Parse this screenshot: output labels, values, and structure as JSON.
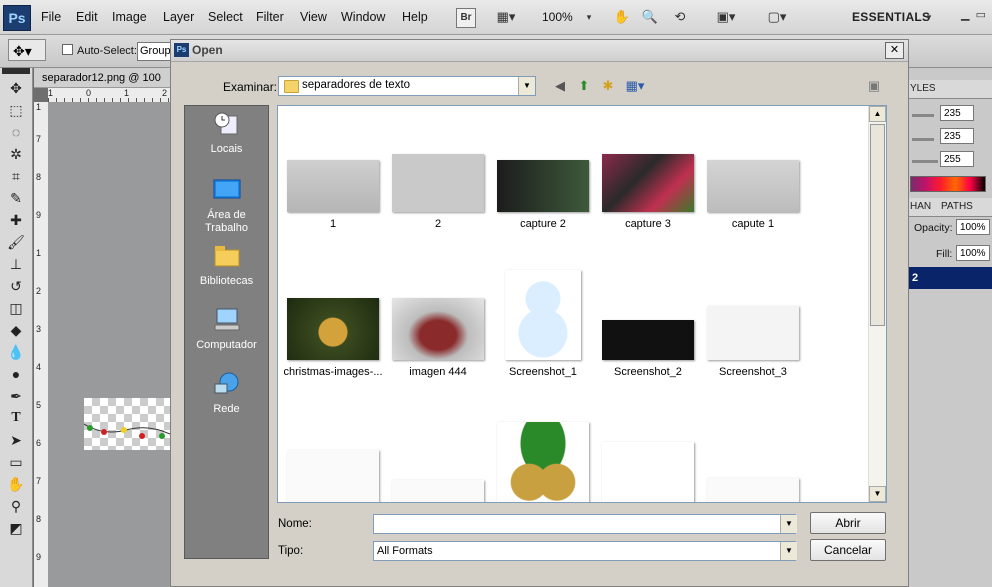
{
  "app": {
    "logo": "Ps"
  },
  "menu": [
    "File",
    "Edit",
    "Image",
    "Layer",
    "Select",
    "Filter",
    "View",
    "Window",
    "Help"
  ],
  "menubar": {
    "bridge": "Br",
    "zoom": "100%",
    "workspace": "ESSENTIALS"
  },
  "options": {
    "auto_select_label": "Auto-Select:",
    "auto_select_value": "Group"
  },
  "document": {
    "tab_title": "separador12.png @ 100",
    "ruler_h": [
      "1",
      "0",
      "1",
      "2"
    ],
    "ruler_v": [
      "1",
      "7",
      "8",
      "9",
      "1",
      "2",
      "3",
      "4",
      "5",
      "6",
      "7",
      "8",
      "9"
    ]
  },
  "right_panel": {
    "tab_styles": "YLES",
    "values": [
      "235",
      "235",
      "255"
    ],
    "tab_channels": "HAN",
    "tab_paths": "PATHS",
    "opacity_label": "Opacity:",
    "opacity_value": "100%",
    "fill_label": "Fill:",
    "fill_value": "100%",
    "layer_row": "2"
  },
  "dialog": {
    "title": "Open",
    "look_in_label": "Examinar:",
    "look_in_value": "separadores de texto",
    "places": [
      "Locais",
      "Área de Trabalho",
      "Bibliotecas",
      "Computador",
      "Rede"
    ],
    "files": [
      "1",
      "2",
      "capture 2",
      "capture 3",
      "capute 1",
      "christmas-images-...",
      "imagen 444",
      "Screenshot_1",
      "Screenshot_2",
      "Screenshot_3",
      "",
      "",
      "",
      "",
      ""
    ],
    "name_label": "Nome:",
    "name_value": "",
    "type_label": "Tipo:",
    "type_value": "All Formats",
    "open_button": "Abrir",
    "cancel_button": "Cancelar"
  }
}
